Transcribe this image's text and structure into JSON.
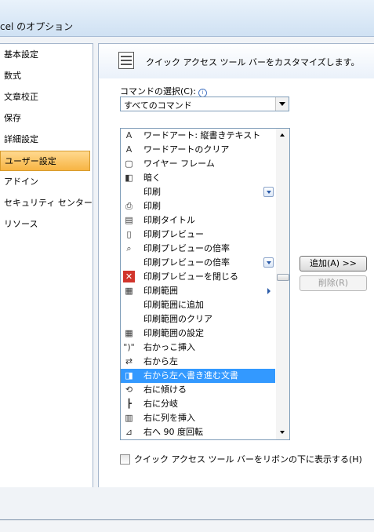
{
  "window": {
    "title": "cel のオプション"
  },
  "sidebar": {
    "items": [
      {
        "label": "基本設定",
        "active": false
      },
      {
        "label": "数式",
        "active": false
      },
      {
        "label": "文章校正",
        "active": false
      },
      {
        "label": "保存",
        "active": false
      },
      {
        "label": "詳細設定",
        "active": false
      },
      {
        "label": "ユーザー設定",
        "active": true
      },
      {
        "label": "アドイン",
        "active": false
      },
      {
        "label": "セキュリティ センター",
        "active": false
      },
      {
        "label": "リソース",
        "active": false
      }
    ]
  },
  "content": {
    "header_text": "クイック アクセス ツール バーをカスタマイズします。",
    "choose_commands_label": "コマンドの選択(C):",
    "choose_commands_value": "すべてのコマンド",
    "commands": [
      {
        "label": "ワードアート: 縦書きテキスト",
        "icon": "wordart-vertical-icon",
        "selected": false
      },
      {
        "label": "ワードアートのクリア",
        "icon": "wordart-clear-icon",
        "selected": false
      },
      {
        "label": "ワイヤー フレーム",
        "icon": "wireframe-icon",
        "selected": false
      },
      {
        "label": "暗く",
        "icon": "darker-icon",
        "selected": false
      },
      {
        "label": "印刷",
        "icon": "",
        "selected": false,
        "dropdown": true
      },
      {
        "label": "印刷",
        "icon": "print-icon",
        "selected": false
      },
      {
        "label": "印刷タイトル",
        "icon": "print-titles-icon",
        "selected": false
      },
      {
        "label": "印刷プレビュー",
        "icon": "print-preview-icon",
        "selected": false
      },
      {
        "label": "印刷プレビューの倍率",
        "icon": "zoom-icon",
        "selected": false
      },
      {
        "label": "印刷プレビューの倍率",
        "icon": "",
        "selected": false,
        "dropdown": true
      },
      {
        "label": "印刷プレビューを閉じる",
        "icon": "close-preview-icon",
        "selected": false
      },
      {
        "label": "印刷範囲",
        "icon": "print-area-icon",
        "selected": false,
        "submenu": true
      },
      {
        "label": "印刷範囲に追加",
        "icon": "",
        "selected": false
      },
      {
        "label": "印刷範囲のクリア",
        "icon": "",
        "selected": false
      },
      {
        "label": "印刷範囲の設定",
        "icon": "set-print-area-icon",
        "selected": false
      },
      {
        "label": "右かっこ挿入",
        "icon": "right-bracket-icon",
        "selected": false
      },
      {
        "label": "右から左",
        "icon": "right-to-left-icon",
        "selected": false
      },
      {
        "label": "右から左へ書き進む文書",
        "icon": "rtl-document-icon",
        "selected": true
      },
      {
        "label": "右に傾ける",
        "icon": "tilt-right-icon",
        "selected": false
      },
      {
        "label": "右に分岐",
        "icon": "branch-right-icon",
        "selected": false
      },
      {
        "label": "右に列を挿入",
        "icon": "insert-column-right-icon",
        "selected": false
      },
      {
        "label": "右へ 90 度回転",
        "icon": "rotate-right-icon",
        "selected": false
      }
    ],
    "add_button": "追加(A) >>",
    "remove_button": "削除(R)",
    "show_below_ribbon_label": "クイック アクセス ツール バーをリボンの下に表示する(H)",
    "show_below_ribbon_checked": false
  }
}
